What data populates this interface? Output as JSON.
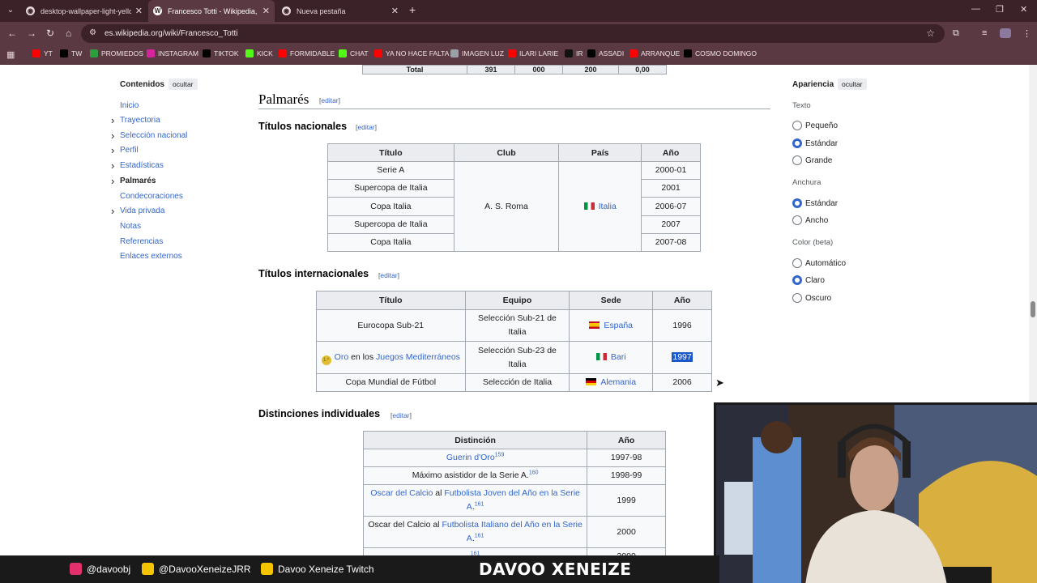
{
  "browser": {
    "tabs": [
      {
        "title": "desktop-wallpaper-light-yellow",
        "active": false
      },
      {
        "title": "Francesco Totti - Wikipedia, la e",
        "active": true
      },
      {
        "title": "Nueva pestaña",
        "active": false
      }
    ],
    "url": "es.wikipedia.org/wiki/Francesco_Totti",
    "bookmarks": [
      {
        "label": "YT",
        "icon": "youtube-icon",
        "color": "#ff0000"
      },
      {
        "label": "TW",
        "icon": "x-icon",
        "color": "#000000"
      },
      {
        "label": "PROMIEDOS",
        "icon": "promiedos-icon",
        "color": "#2e9d3e"
      },
      {
        "label": "INSTAGRAM",
        "icon": "instagram-icon",
        "color": "#d6249f"
      },
      {
        "label": "TIKTOK",
        "icon": "tiktok-icon",
        "color": "#000000"
      },
      {
        "label": "KICK",
        "icon": "kick-icon",
        "color": "#53fc18"
      },
      {
        "label": "FORMIDABLE",
        "icon": "youtube-icon",
        "color": "#ff0000"
      },
      {
        "label": "CHAT",
        "icon": "kick-icon",
        "color": "#53fc18"
      },
      {
        "label": "YA NO HACE FALTA",
        "icon": "youtube-icon",
        "color": "#ff0000"
      },
      {
        "label": "IMAGEN LUZ",
        "icon": "globe-icon",
        "color": "#9aa0a6"
      },
      {
        "label": "ILARI LARIE",
        "icon": "youtube-icon",
        "color": "#ff0000"
      },
      {
        "label": "IR",
        "icon": "mk-icon",
        "color": "#111111"
      },
      {
        "label": "ASSADI",
        "icon": "x-icon",
        "color": "#000000"
      },
      {
        "label": "ARRANQUE",
        "icon": "youtube-icon",
        "color": "#ff0000"
      },
      {
        "label": "COSMO DOMINGO",
        "icon": "x-icon",
        "color": "#000000"
      }
    ]
  },
  "toc": {
    "title": "Contenidos",
    "hide_label": "ocultar",
    "items": [
      {
        "label": "Inicio",
        "expandable": false,
        "current": false
      },
      {
        "label": "Trayectoria",
        "expandable": true,
        "current": false
      },
      {
        "label": "Selección nacional",
        "expandable": true,
        "current": false
      },
      {
        "label": "Perfil",
        "expandable": true,
        "current": false
      },
      {
        "label": "Estadísticas",
        "expandable": true,
        "current": false
      },
      {
        "label": "Palmarés",
        "expandable": true,
        "current": true
      },
      {
        "label": "Condecoraciones",
        "expandable": false,
        "current": false
      },
      {
        "label": "Vida privada",
        "expandable": true,
        "current": false
      },
      {
        "label": "Notas",
        "expandable": false,
        "current": false
      },
      {
        "label": "Referencias",
        "expandable": false,
        "current": false
      },
      {
        "label": "Enlaces externos",
        "expandable": false,
        "current": false
      }
    ]
  },
  "article": {
    "prev_table_total": {
      "label": "Total",
      "values": [
        "391",
        "000",
        "200",
        "0,00"
      ]
    },
    "palmares_heading": "Palmarés",
    "edit_open": "[",
    "edit_label": "editar",
    "edit_close": "]",
    "nacionales": {
      "heading": "Títulos nacionales",
      "headers": [
        "Título",
        "Club",
        "País",
        "Año"
      ],
      "club": "A. S. Roma",
      "country": "Italia",
      "rows": [
        {
          "title": "Serie A",
          "year": "2000-01"
        },
        {
          "title": "Supercopa de Italia",
          "year": "2001"
        },
        {
          "title": "Copa Italia",
          "year": "2006-07"
        },
        {
          "title": "Supercopa de Italia",
          "year": "2007"
        },
        {
          "title": "Copa Italia",
          "year": "2007-08"
        }
      ]
    },
    "internacionales": {
      "heading": "Títulos internacionales",
      "headers": [
        "Título",
        "Equipo",
        "Sede",
        "Año"
      ],
      "rows": [
        {
          "title": "Eurocopa Sub-21",
          "team": "Selección Sub-21 de Italia",
          "venue": "España",
          "flag": "es",
          "year": "1996"
        },
        {
          "title_a": "Oro",
          "title_b": " en los ",
          "title_c": "Juegos Mediterráneos",
          "medal_text": "1.º",
          "team": "Selección Sub-23 de Italia",
          "venue": "Bari",
          "flag": "it",
          "year": "1997",
          "selected": true
        },
        {
          "title": "Copa Mundial de Fútbol",
          "team": "Selección de Italia",
          "venue": "Alemania",
          "flag": "de",
          "year": "2006"
        }
      ]
    },
    "distinciones": {
      "heading": "Distinciones individuales",
      "headers": [
        "Distinción",
        "Año"
      ],
      "rows": [
        {
          "parts": [
            {
              "t": "Guerin d'Oro",
              "link": true
            }
          ],
          "ref": "159",
          "year": "1997-98",
          "year_link": false
        },
        {
          "parts": [
            {
              "t": "Máximo asistidor de la Serie A.",
              "link": false
            }
          ],
          "ref": "160",
          "year": "1998-99",
          "year_link": true
        },
        {
          "parts": [
            {
              "t": "Oscar del Calcio",
              "link": true
            },
            {
              "t": " al ",
              "link": false
            },
            {
              "t": "Futbolista Joven del Año en la Serie A",
              "link": true
            },
            {
              "t": ".",
              "link": false
            }
          ],
          "ref": "161",
          "year": "1999",
          "year_link": false
        },
        {
          "parts": [
            {
              "t": "Oscar del Calcio al ",
              "link": false
            },
            {
              "t": "Futbolista Italiano del Año en la Serie A",
              "link": true
            },
            {
              "t": ".",
              "link": false
            }
          ],
          "ref": "161",
          "year": "2000",
          "year_link": false
        }
      ],
      "partial_row_ref": "161",
      "partial_row_year": "2000"
    }
  },
  "appearance": {
    "title": "Apariencia",
    "hide_label": "ocultar",
    "groups": [
      {
        "label": "Texto",
        "options": [
          {
            "label": "Pequeño",
            "selected": false
          },
          {
            "label": "Estándar",
            "selected": true
          },
          {
            "label": "Grande",
            "selected": false
          }
        ]
      },
      {
        "label": "Anchura",
        "options": [
          {
            "label": "Estándar",
            "selected": true
          },
          {
            "label": "Ancho",
            "selected": false
          }
        ]
      },
      {
        "label": "Color (beta)",
        "options": [
          {
            "label": "Automático",
            "selected": false
          },
          {
            "label": "Claro",
            "selected": true
          },
          {
            "label": "Oscuro",
            "selected": false
          }
        ]
      }
    ]
  },
  "overlay": {
    "socials": [
      {
        "handle": "@davoobj",
        "icon": "instagram-icon",
        "color": "#e1306c"
      },
      {
        "handle": "@DavooXeneizeJRR",
        "icon": "twitter-bird-icon",
        "color": "#f5c400"
      },
      {
        "handle": "Davoo Xeneize Twitch",
        "icon": "youtube-icon",
        "color": "#f5c400"
      }
    ],
    "brand": "DAVOO XENEIZE"
  }
}
